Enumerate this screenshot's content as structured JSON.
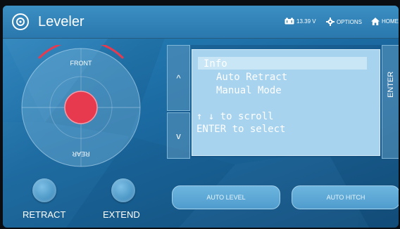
{
  "header": {
    "title": "Leveler",
    "battery_voltage": "13.39 V",
    "options_label": "OPTIONS",
    "home_label": "HOME"
  },
  "pad": {
    "front_label": "FRONT",
    "rear_label": "REAR"
  },
  "controls": {
    "retract_label": "RETRACT",
    "extend_label": "EXTEND",
    "auto_level_label": "AUTO LEVEL",
    "auto_hitch_label": "AUTO HITCH",
    "enter_label": "ENTER",
    "up_symbol": "^",
    "down_symbol": "v"
  },
  "menu": {
    "items": [
      "Info",
      "Auto Retract",
      "Manual Mode"
    ],
    "selected_index": 0,
    "hint_lines": [
      "↑ ↓ to scroll",
      "ENTER to select"
    ]
  },
  "colors": {
    "background": "#1b6aa1",
    "indicator": "#e83a4f",
    "panel": "#a7d3ef"
  },
  "icons": {
    "title": "level-target-icon",
    "battery": "battery-icon",
    "options": "gear-icon",
    "home": "home-icon"
  }
}
